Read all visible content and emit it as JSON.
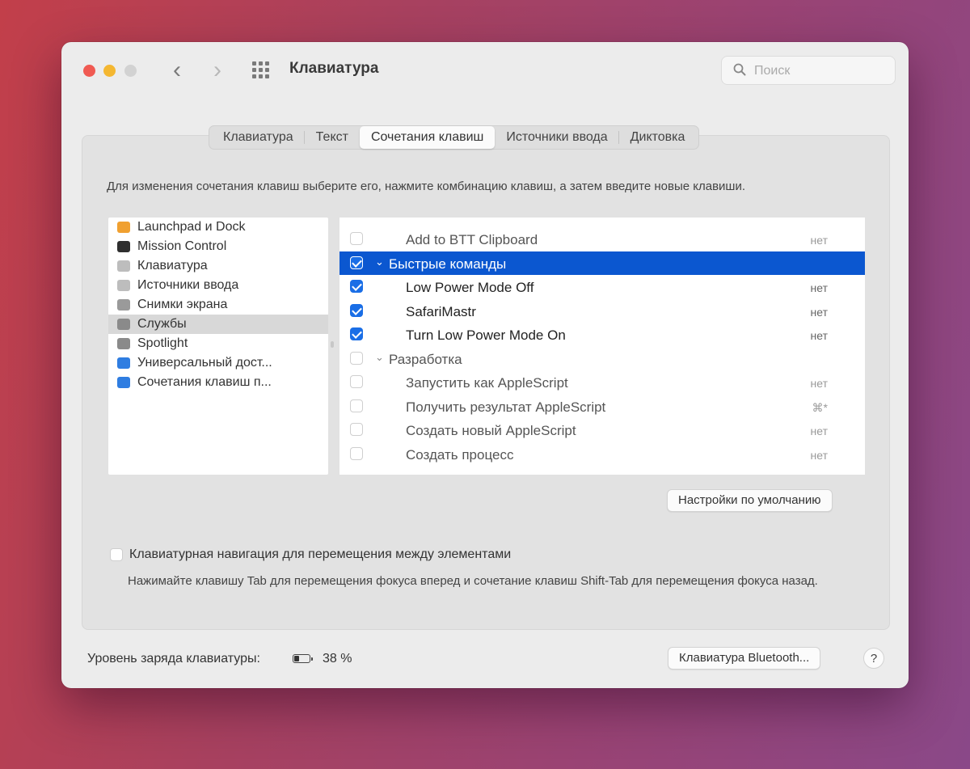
{
  "window": {
    "title": "Клавиатура",
    "search_placeholder": "Поиск"
  },
  "tabs": [
    {
      "label": "Клавиатура",
      "active": false
    },
    {
      "label": "Текст",
      "active": false
    },
    {
      "label": "Сочетания клавиш",
      "active": true
    },
    {
      "label": "Источники ввода",
      "active": false
    },
    {
      "label": "Диктовка",
      "active": false
    }
  ],
  "instructions": "Для изменения сочетания клавиш выберите его, нажмите комбинацию клавиш, а затем введите новые клавиши.",
  "categories": [
    {
      "label": "Launchpad и Dock",
      "icon": "launchpad-icon",
      "color": "#f0a030",
      "selected": false
    },
    {
      "label": "Mission Control",
      "icon": "mission-control-icon",
      "color": "#2f2f2f",
      "selected": false
    },
    {
      "label": "Клавиатура",
      "icon": "keyboard-icon",
      "color": "#bdbdbd",
      "selected": false
    },
    {
      "label": "Источники ввода",
      "icon": "input-sources-icon",
      "color": "#bdbdbd",
      "selected": false
    },
    {
      "label": "Снимки экрана",
      "icon": "screenshot-icon",
      "color": "#9a9a9a",
      "selected": false
    },
    {
      "label": "Службы",
      "icon": "gear-icon",
      "color": "#8a8a8a",
      "selected": true
    },
    {
      "label": "Spotlight",
      "icon": "spotlight-icon",
      "color": "#8a8a8a",
      "selected": false
    },
    {
      "label": "Универсальный дост...",
      "icon": "accessibility-icon",
      "color": "#2f7de1",
      "selected": false
    },
    {
      "label": "Сочетания клавиш п...",
      "icon": "app-shortcuts-icon",
      "color": "#2f7de1",
      "selected": false
    }
  ],
  "shortcuts": [
    {
      "label": "Add to BTT Clipboard",
      "shortcut": "нет",
      "checked": false,
      "group": false,
      "highlight": false,
      "dim": true
    },
    {
      "label": "Быстрые команды",
      "shortcut": "",
      "checked": true,
      "group": true,
      "highlight": true,
      "dim": false
    },
    {
      "label": "Low Power Mode Off",
      "shortcut": "нет",
      "checked": true,
      "group": false,
      "highlight": false,
      "dim": false
    },
    {
      "label": "SafariMastr",
      "shortcut": "нет",
      "checked": true,
      "group": false,
      "highlight": false,
      "dim": false
    },
    {
      "label": "Turn Low Power Mode On",
      "shortcut": "нет",
      "checked": true,
      "group": false,
      "highlight": false,
      "dim": false
    },
    {
      "label": "Разработка",
      "shortcut": "",
      "checked": false,
      "group": true,
      "highlight": false,
      "dim": true
    },
    {
      "label": "Запустить как AppleScript",
      "shortcut": "нет",
      "checked": false,
      "group": false,
      "highlight": false,
      "dim": true
    },
    {
      "label": "Получить результат AppleScript",
      "shortcut": "⌘*",
      "checked": false,
      "group": false,
      "highlight": false,
      "dim": true
    },
    {
      "label": "Создать новый AppleScript",
      "shortcut": "нет",
      "checked": false,
      "group": false,
      "highlight": false,
      "dim": true
    },
    {
      "label": "Создать процесс",
      "shortcut": "нет",
      "checked": false,
      "group": false,
      "highlight": false,
      "dim": true
    }
  ],
  "defaults_button": "Настройки по умолчанию",
  "keyboard_navigation": {
    "label": "Клавиатурная навигация для перемещения между элементами",
    "checked": false,
    "description": "Нажимайте клавишу Tab для перемещения фокуса вперед и сочетание клавиш Shift-Tab для перемещения фокуса назад."
  },
  "footer": {
    "battery_label": "Уровень заряда клавиатуры:",
    "battery_level": 0.38,
    "battery_percent": "38 %",
    "bluetooth_button": "Клавиатура Bluetooth...",
    "help": "?"
  },
  "colors": {
    "accent": "#0b57d0",
    "checkbox": "#1a6ee6",
    "close": "#f05a52",
    "minimize": "#f4b731"
  }
}
